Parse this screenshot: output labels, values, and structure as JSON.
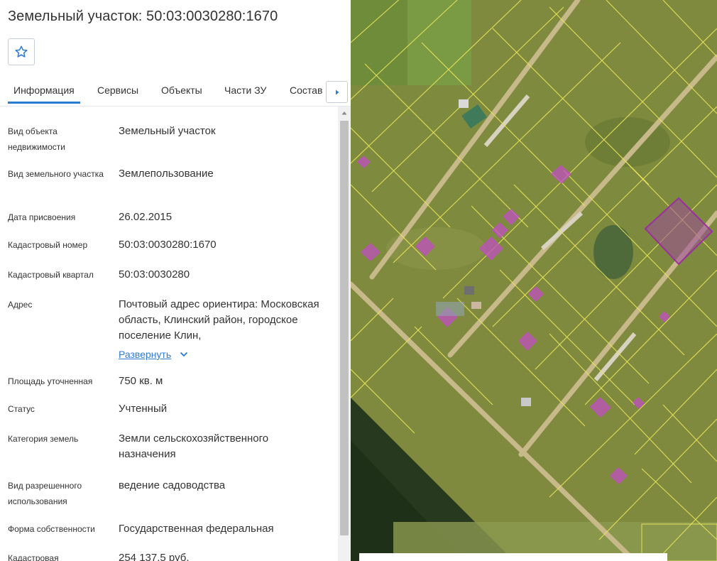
{
  "header": {
    "title": "Земельный участок: 50:03:0030280:1670"
  },
  "tabs": [
    {
      "label": "Информация",
      "active": true
    },
    {
      "label": "Сервисы"
    },
    {
      "label": "Объекты"
    },
    {
      "label": "Части ЗУ"
    },
    {
      "label": "Состав"
    }
  ],
  "properties": [
    {
      "label": "Вид объекта недвижимости",
      "value": "Земельный участок"
    },
    {
      "label": "Вид земельного участка",
      "value": "Землепользование"
    },
    {
      "label": "Дата присвоения",
      "value": "26.02.2015"
    },
    {
      "label": "Кадастровый номер",
      "value": "50:03:0030280:1670"
    },
    {
      "label": "Кадастровый квартал",
      "value": "50:03:0030280"
    },
    {
      "label": "Адрес",
      "value": "Почтовый адрес ориентира: Московская область, Клинский район, городское поселение Клин,",
      "expand_label": "Развернуть"
    },
    {
      "label": "Площадь уточненная",
      "value": "750 кв. м"
    },
    {
      "label": "Статус",
      "value": "Учтенный"
    },
    {
      "label": "Категория земель",
      "value": "Земли сельскохозяйственного назначения"
    },
    {
      "label": "Вид разрешенного использования",
      "value": "ведение садоводства"
    },
    {
      "label": "Форма собственности",
      "value": "Государственная федеральная"
    },
    {
      "label": "Кадастровая",
      "value": "254 137,5 руб."
    }
  ],
  "icons": {
    "favorite": "star-icon",
    "tabs_next": "caret-right-icon",
    "expand": "chevron-down-icon",
    "scroll_up": "caret-up-icon"
  },
  "colors": {
    "accent": "#2b7bd2",
    "parcel_line": "#e8e35a",
    "building_fill": "#c04fc0",
    "selected_parcel": "#9b2fa0"
  }
}
